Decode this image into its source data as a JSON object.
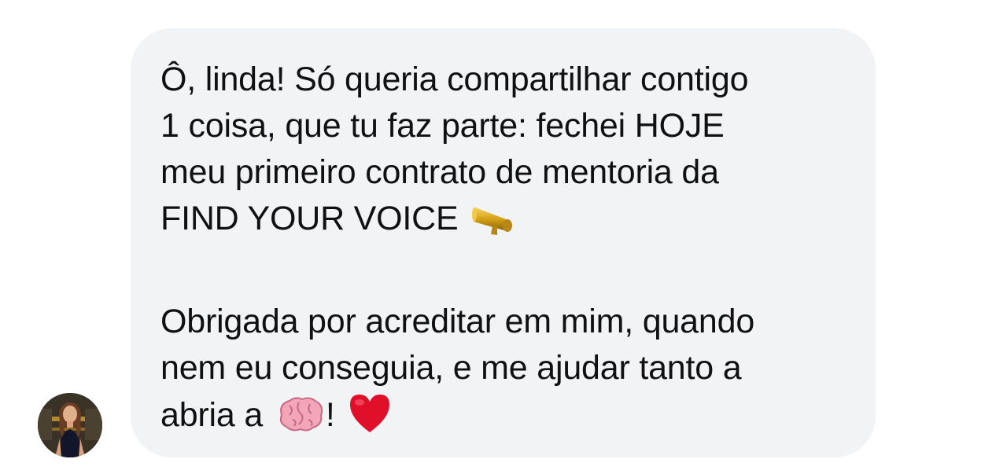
{
  "message": {
    "paragraph1": [
      "Ô, linda! Só queria compartilhar contigo",
      "1 coisa, que tu faz parte: fechei HOJE",
      "meu primeiro contrato de mentoria da",
      "FIND YOUR VOICE"
    ],
    "paragraph2": [
      "Obrigada por acreditar em mim, quando",
      "nem eu conseguia, e me ajudar tanto a",
      "abria a",
      "!"
    ],
    "emojis": [
      "megaphone-icon",
      "brain-icon",
      "red-heart-icon"
    ]
  },
  "colors": {
    "bubble": "#f2f3f5",
    "text": "#111111",
    "heart": "#e0102b",
    "megaphone": "#d4a017",
    "brain": "#f2a6b8"
  }
}
